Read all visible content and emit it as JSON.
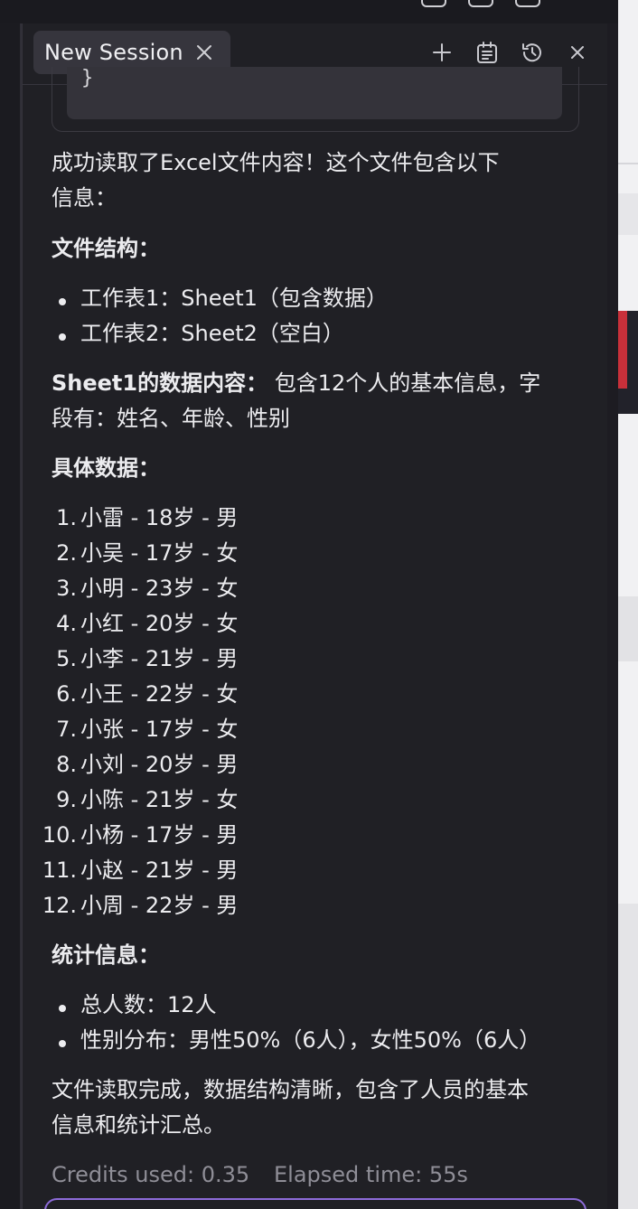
{
  "header": {
    "tab_title": "New Session",
    "icons": [
      "plus-icon",
      "notes-icon",
      "history-icon",
      "close-icon"
    ]
  },
  "code": {
    "closing_brace": "}"
  },
  "message": {
    "intro_line1": "成功读取了Excel文件内容！这个文件包含以下",
    "intro_line2": "信息：",
    "structure_heading": "文件结构：",
    "structure_items": [
      "工作表1：Sheet1（包含数据）",
      "工作表2：Sheet2（空白）"
    ],
    "sheet_heading": "Sheet1的数据内容：",
    "sheet_text_line1": "包含12个人的基本信息，字",
    "sheet_text_line2": "段有：姓名、年龄、性别",
    "data_heading": "具体数据：",
    "data_items": [
      "小雷 - 18岁 - 男",
      "小吴 - 17岁 - 女",
      "小明 - 23岁 - 女",
      "小红 - 20岁 - 女",
      "小李 - 21岁 - 男",
      "小王 - 22岁 - 女",
      "小张 - 17岁 - 女",
      "小刘 - 20岁 - 男",
      "小陈 - 21岁 - 女",
      "小杨 - 17岁 - 男",
      "小赵 - 21岁 - 男",
      "小周 - 22岁 - 男"
    ],
    "data_numbers": [
      "1.",
      "2.",
      "3.",
      "4.",
      "5.",
      "6.",
      "7.",
      "8.",
      "9.",
      "10.",
      "11.",
      "12."
    ],
    "stats_heading": "统计信息：",
    "stats_items": [
      "总人数：12人",
      "性别分布：男性50%（6人），女性50%（6人）"
    ],
    "conclusion_line1": "文件读取完成，数据结构清晰，包含了人员的基本",
    "conclusion_line2": "信息和统计汇总。"
  },
  "footer": {
    "credits": "Credits used: 0.35",
    "elapsed": "Elapsed time: 55s"
  },
  "colors": {
    "panel_bg": "#202025",
    "tab_bg": "#36353d",
    "text": "#ececef",
    "muted": "#8f8e97",
    "accent": "#8d6bd9"
  }
}
